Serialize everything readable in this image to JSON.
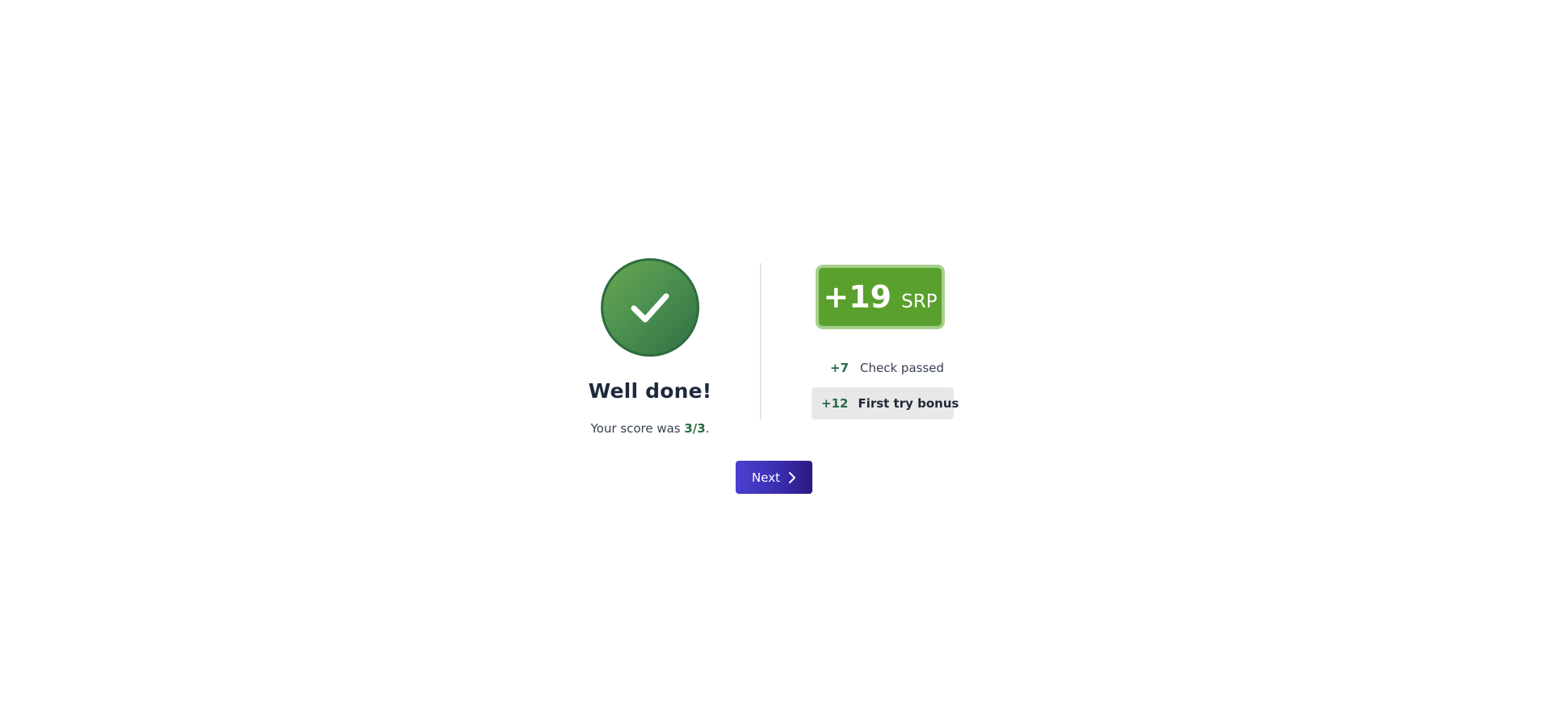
{
  "result": {
    "headline": "Well done!",
    "score_prefix": "Your score was ",
    "score_value": "3/3",
    "score_suffix": ".",
    "icon": "checkmark-icon",
    "success_color": "#4c9150"
  },
  "reward": {
    "amount": "+19",
    "unit": "SRP",
    "badge_color": "#5aa02c",
    "breakdown": [
      {
        "amount": "+7",
        "label": "Check passed"
      },
      {
        "amount": "+12",
        "label": "First try bonus"
      }
    ]
  },
  "actions": {
    "next_label": "Next",
    "next_icon": "chevron-right-icon",
    "button_color": "#3b2fb0"
  }
}
